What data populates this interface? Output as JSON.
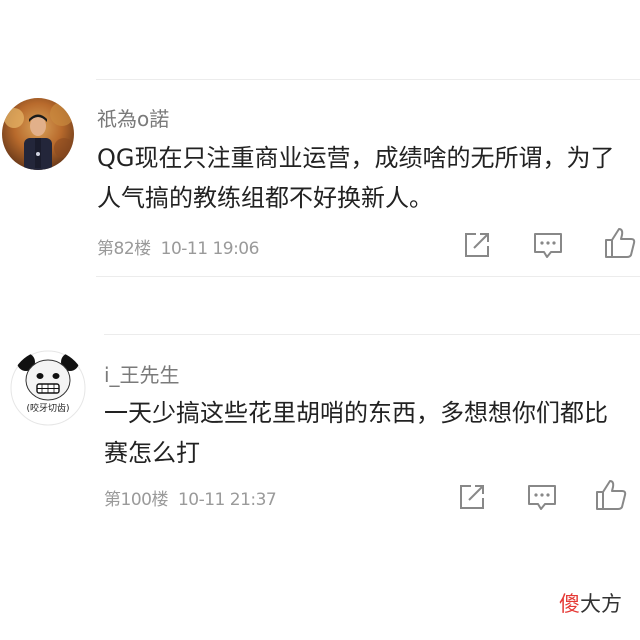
{
  "comments": [
    {
      "username": "祇為o諾",
      "text": "QG现在只注重商业运营，成绩啥的无所谓，为了人气搞的教练组都不好换新人。",
      "floor": "第82楼",
      "time": "10-11  19:06",
      "avatar_icon": "user-photo-avatar"
    },
    {
      "username": "i_王先生",
      "text": "一天少搞这些花里胡哨的东西，多想想你们都比赛怎么打",
      "floor": "第100楼",
      "time": "10-11  21:37",
      "avatar_icon": "panda-meme-avatar",
      "avatar_caption": "(咬牙切齿)"
    }
  ],
  "actions": {
    "share_icon": "share-icon",
    "reply_icon": "comment-icon",
    "like_icon": "thumbs-up-icon"
  },
  "watermark": {
    "accent": "傻",
    "rest": "大方",
    "accent_color": "#e53935"
  }
}
